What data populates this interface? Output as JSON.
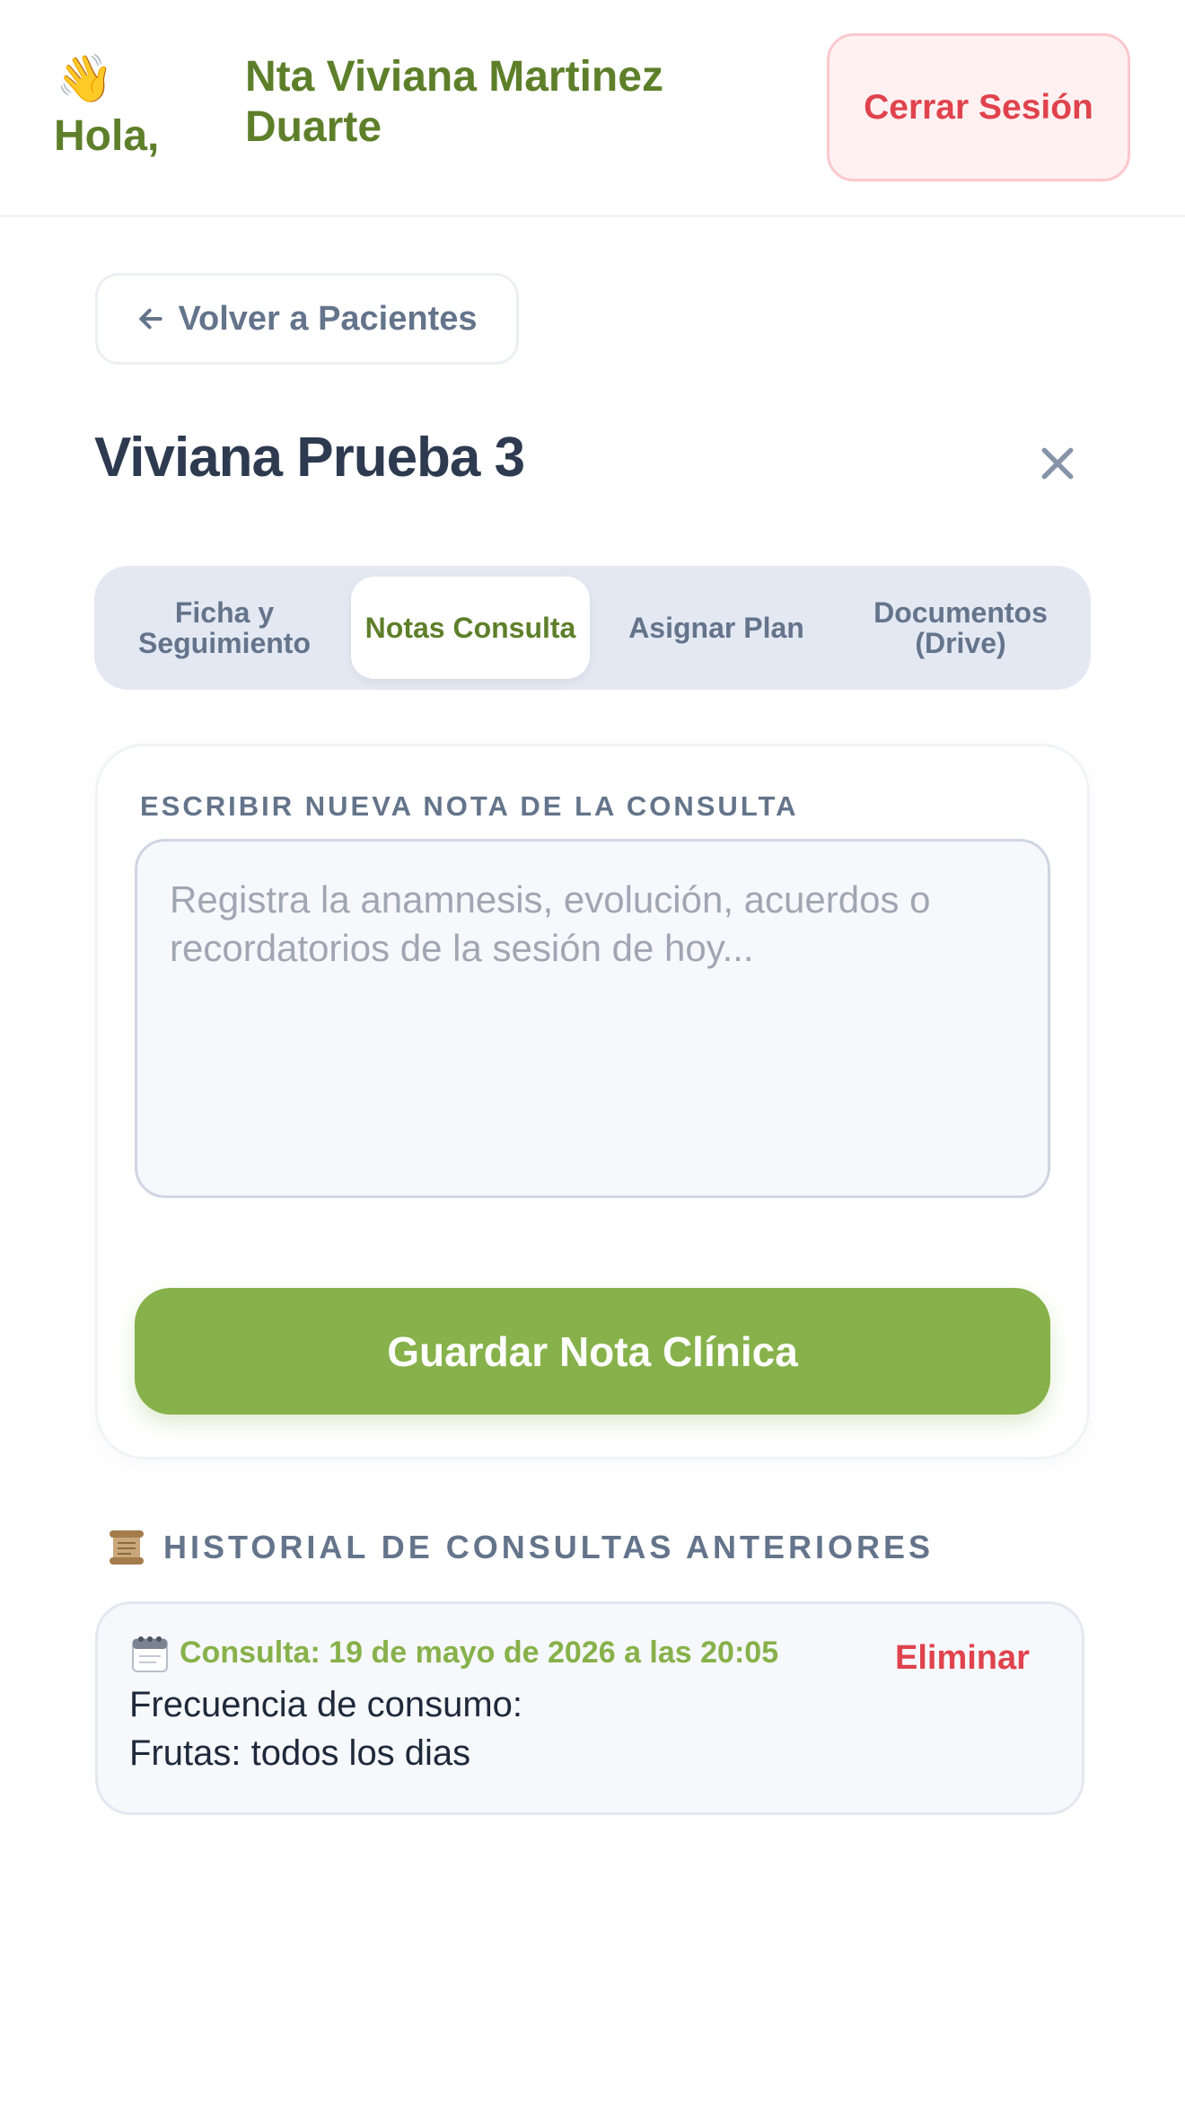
{
  "header": {
    "greeting": "Hola,",
    "user_name": "Nta Viviana Martinez Duarte",
    "logout_label": "Cerrar Sesión"
  },
  "nav": {
    "back_label": "Volver a Pacientes"
  },
  "patient": {
    "name": "Viviana Prueba 3"
  },
  "tabs": [
    {
      "label": "Ficha y Seguimiento",
      "active": false
    },
    {
      "label": "Notas Consulta",
      "active": true
    },
    {
      "label": "Asignar Plan",
      "active": false
    },
    {
      "label": "Documentos (Drive)",
      "active": false
    }
  ],
  "note_form": {
    "section_label": "ESCRIBIR NUEVA NOTA DE LA CONSULTA",
    "placeholder": "Registra la anamnesis, evolución, acuerdos o recordatorios de la sesión de hoy...",
    "value": "",
    "save_label": "Guardar Nota Clínica"
  },
  "history": {
    "title": "HISTORIAL DE CONSULTAS ANTERIORES",
    "items": [
      {
        "date_label": "Consulta: 19 de mayo de 2026 a las 20:05",
        "delete_label": "Eliminar",
        "lines": [
          "Frecuencia de consumo:",
          "Frutas: todos los dias"
        ]
      }
    ]
  },
  "colors": {
    "brand_green": "#87b14a",
    "dark_green": "#5e7f2a",
    "danger_red": "#e0434d",
    "muted_slate": "#64748b"
  },
  "icons": {
    "wave": "waving-hand-icon",
    "back": "arrow-left-icon",
    "close": "close-icon",
    "history": "scroll-icon",
    "calendar": "calendar-icon"
  }
}
